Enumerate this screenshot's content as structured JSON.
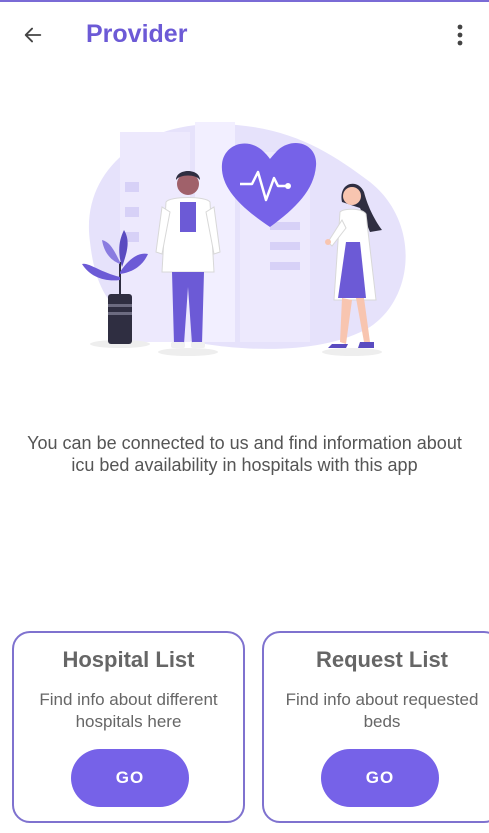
{
  "appbar": {
    "title": "Provider",
    "back_icon": "arrow-left-icon",
    "menu_icon": "more-vert-icon"
  },
  "colors": {
    "accent": "#6c5ad6",
    "button": "#7662e8",
    "card_border": "#7f72cf"
  },
  "main": {
    "description": "You can be connected to us and find information about icu bed availability in hospitals with this app"
  },
  "cards": [
    {
      "title": "Hospital List",
      "description": "Find info about different hospitals here",
      "button_label": "GO"
    },
    {
      "title": "Request List",
      "description": "Find info about requested beds",
      "button_label": "GO"
    }
  ]
}
